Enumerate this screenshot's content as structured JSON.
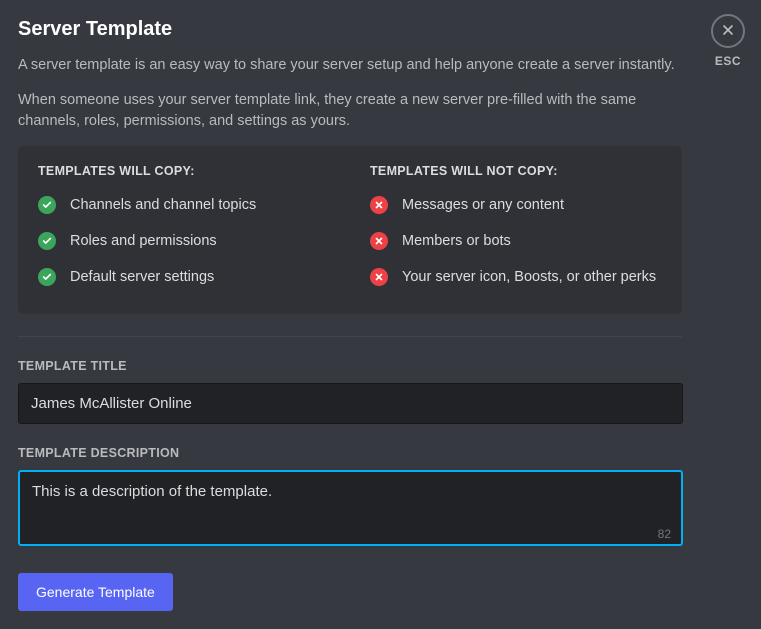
{
  "header": {
    "title": "Server Template",
    "close_label": "ESC"
  },
  "intro": {
    "p1": "A server template is an easy way to share your server setup and help anyone create a server instantly.",
    "p2": "When someone uses your server template link, they create a new server pre-filled with the same channels, roles, permissions, and settings as yours."
  },
  "copy_info": {
    "will_title": "TEMPLATES WILL COPY:",
    "will_not_title": "TEMPLATES WILL NOT COPY:",
    "will": [
      "Channels and channel topics",
      "Roles and permissions",
      "Default server settings"
    ],
    "will_not": [
      "Messages or any content",
      "Members or bots",
      "Your server icon, Boosts, or other perks"
    ]
  },
  "form": {
    "title_label": "TEMPLATE TITLE",
    "title_value": "James McAllister Online",
    "desc_label": "TEMPLATE DESCRIPTION",
    "desc_value": "This is a description of the template.",
    "desc_remaining": "82",
    "generate_label": "Generate Template"
  }
}
